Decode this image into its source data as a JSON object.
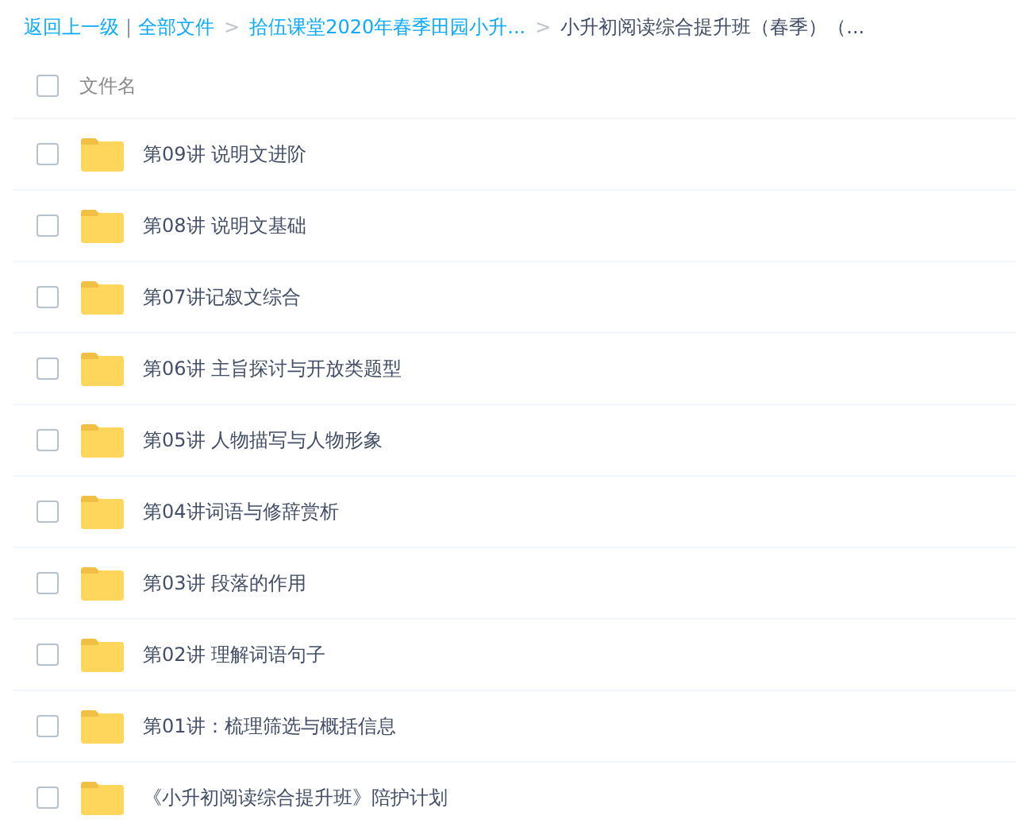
{
  "breadcrumb": {
    "back": "返回上一级",
    "separator": "|",
    "links": [
      "全部文件",
      "拾伍课堂2020年春季田园小升..."
    ],
    "arrow": ">",
    "current": "小升初阅读综合提升班（春季）（..."
  },
  "header": {
    "checked": false,
    "label": "文件名"
  },
  "files": [
    {
      "name": "第09讲 说明文进阶",
      "checked": false
    },
    {
      "name": "第08讲 说明文基础",
      "checked": false
    },
    {
      "name": "第07讲记叙文综合",
      "checked": false
    },
    {
      "name": "第06讲 主旨探讨与开放类题型",
      "checked": false
    },
    {
      "name": "第05讲 人物描写与人物形象",
      "checked": false
    },
    {
      "name": "第04讲词语与修辞赏析",
      "checked": false
    },
    {
      "name": "第03讲 段落的作用",
      "checked": false
    },
    {
      "name": "第02讲 理解词语句子",
      "checked": false
    },
    {
      "name": "第01讲：梳理筛选与概括信息",
      "checked": false
    },
    {
      "name": "《小升初阅读综合提升班》陪护计划",
      "checked": false
    }
  ]
}
